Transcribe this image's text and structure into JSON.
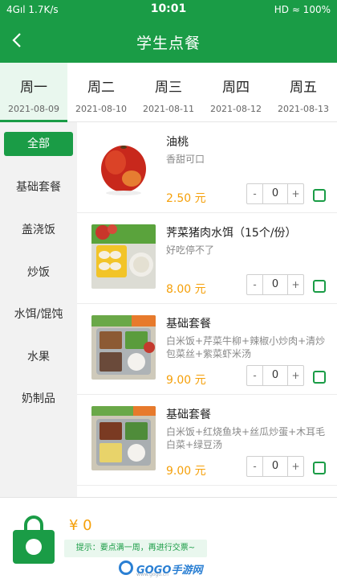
{
  "status_bar": {
    "network": "4Gıl 1.7K/s",
    "time": "10:01",
    "indicators": "HD ≈ 100%",
    "battery_icon": "battery-icon"
  },
  "header": {
    "title": "学生点餐",
    "back_icon": "back-arrow-icon",
    "bg_color": "#1a9c46"
  },
  "days": [
    {
      "name": "周一",
      "date": "2021-08-09",
      "active": true
    },
    {
      "name": "周二",
      "date": "2021-08-10"
    },
    {
      "name": "周三",
      "date": "2021-08-11"
    },
    {
      "name": "周四",
      "date": "2021-08-12"
    },
    {
      "name": "周五",
      "date": "2021-08-13"
    }
  ],
  "categories": [
    {
      "label": "全部",
      "active": true
    },
    {
      "label": "基础套餐"
    },
    {
      "label": "盖浇饭"
    },
    {
      "label": "炒饭"
    },
    {
      "label": "水饵/馄饨"
    },
    {
      "label": "水果"
    },
    {
      "label": "奶制品"
    }
  ],
  "items": [
    {
      "name": "油桃",
      "desc": "香甜可口",
      "price": "2.50 元",
      "qty": "0",
      "image_icon": "peach-image"
    },
    {
      "name": "荠菜猪肉水饵（15个/份）",
      "desc": "好吃停不了",
      "price": "8.00 元",
      "qty": "0",
      "image_icon": "dumplings-image"
    },
    {
      "name": "基础套餐",
      "desc": "白米饭+芹菜牛柳+辣椒小炒肉+清炒包菜丝+紫菜虾米汤",
      "price": "9.00 元",
      "qty": "0",
      "image_icon": "meal-tray-image"
    },
    {
      "name": "基础套餐",
      "desc": "白米饭+红烧鱼块+丝瓜炒蛋+木耳毛白菜+绿豆汤",
      "price": "9.00 元",
      "qty": "0",
      "image_icon": "meal-tray-image"
    }
  ],
  "stepper": {
    "minus": "-",
    "plus": "+"
  },
  "footer": {
    "total": "¥ 0",
    "tip": "提示：要点满一周，再进行交票~",
    "bag_icon": "shopping-bag-icon"
  },
  "watermark": {
    "text": "GOGO手游网",
    "sub": "www.gogo.cn"
  },
  "colors": {
    "accent": "#1a9c46",
    "price": "#f5a00a",
    "sidebar_bg": "#f2f2f2"
  }
}
